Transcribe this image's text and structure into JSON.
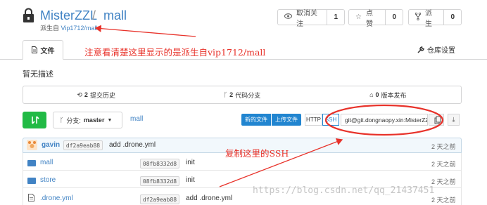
{
  "repo": {
    "owner": "MisterZZL",
    "separator": "/",
    "name": "mall",
    "fork_prefix": "派生自",
    "fork_source": "Vip1712/mall",
    "icon": "repo-lock-icon"
  },
  "actions": {
    "watch": {
      "label": "取消关注",
      "count": "1",
      "icon": "eye-icon"
    },
    "star": {
      "label": "点赞",
      "count": "0",
      "icon": "star-icon"
    },
    "fork": {
      "label": "派生",
      "count": "0",
      "icon": "fork-icon"
    }
  },
  "tabs": {
    "files": {
      "label": "文件",
      "icon": "file-icon"
    },
    "settings": {
      "label": "仓库设置",
      "icon": "wrench-icon"
    }
  },
  "description": "暂无描述",
  "stats": {
    "commits": {
      "count": "2",
      "label": "提交历史",
      "icon": "history-icon"
    },
    "branches": {
      "count": "2",
      "label": "代码分支",
      "icon": "branch-icon"
    },
    "releases": {
      "count": "0",
      "label": "版本发布",
      "icon": "tag-icon"
    }
  },
  "toolbar": {
    "branch_label": "分支:",
    "branch_value": "master",
    "breadcrumb": "mall",
    "new_file": "新的文件",
    "upload_file": "上传文件",
    "http": "HTTP",
    "ssh": "SSH",
    "clone_url": "git@git.dongnaopy.xin:MisterZZL/mall.git"
  },
  "latest_commit": {
    "user": "gavin",
    "sha": "df2a9eab88",
    "message": "add .drone.yml",
    "time": "2 天之前"
  },
  "files": [
    {
      "name": "mall",
      "type": "folder",
      "sha": "08fb8332d8",
      "message": "init",
      "time": "2 天之前"
    },
    {
      "name": "store",
      "type": "folder",
      "sha": "08fb8332d8",
      "message": "init",
      "time": "2 天之前"
    },
    {
      "name": ".drone.yml",
      "type": "file",
      "sha": "df2a9eab88",
      "message": "add .drone.yml",
      "time": "2 天之前"
    }
  ],
  "annotations": {
    "note1": "注意看清楚这里显示的是派生自vip1712/mall",
    "note2": "复制这里的SSH",
    "color": "#e8322a"
  },
  "watermark": "https://blog.csdn.net/qq_21437451"
}
